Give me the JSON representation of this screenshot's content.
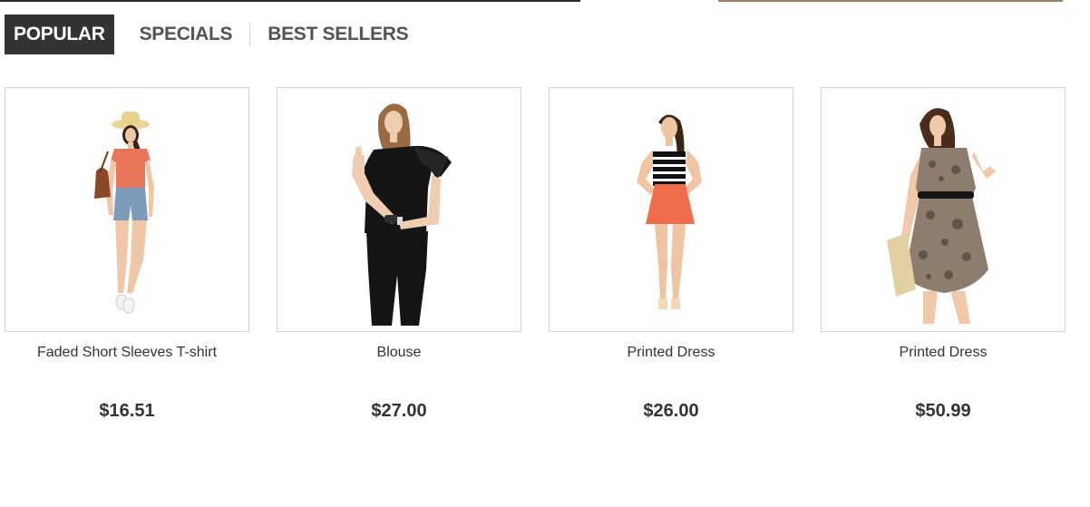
{
  "tabs": [
    {
      "label": "POPULAR",
      "active": true
    },
    {
      "label": "SPECIALS",
      "active": false
    },
    {
      "label": "BEST SELLERS",
      "active": false
    }
  ],
  "products": [
    {
      "name": "Faded Short Sleeves T-shirt",
      "price": "$16.51",
      "image": "woman-in-orange-top-and-denim-shorts-with-hat"
    },
    {
      "name": "Blouse",
      "price": "$27.00",
      "image": "woman-in-black-ruffled-blouse-and-black-pants"
    },
    {
      "name": "Printed Dress",
      "price": "$26.00",
      "image": "woman-in-striped-top-and-orange-skirt"
    },
    {
      "name": "Printed Dress",
      "price": "$50.99",
      "image": "woman-in-patterned-dress-holding-clutch"
    }
  ],
  "colors": {
    "active_tab_bg": "#333333",
    "tab_text": "#555454",
    "border": "#d6d4d4",
    "text": "#333333"
  }
}
